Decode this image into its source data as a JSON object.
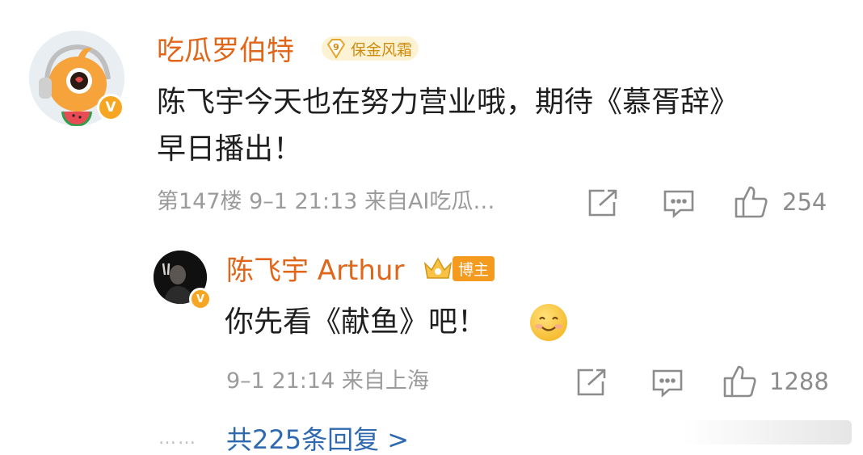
{
  "comment": {
    "username": "吃瓜罗伯特",
    "badge": {
      "level": "9",
      "label": "保金风霜"
    },
    "text_line1": "陈飞宇今天也在努力营业哦，期待《慕胥辞》",
    "text_line2": "早日播出！",
    "meta": "第147楼  9–1 21:13  来自AI吃瓜…",
    "likes": "254"
  },
  "reply": {
    "username": "陈飞宇 Arthur",
    "badge": {
      "label": "博主"
    },
    "text": "你先看《献鱼》吧！",
    "emoji": "😊",
    "meta": "9–1 21:14  来自上海",
    "likes": "1288"
  },
  "footer": {
    "dots": "……",
    "more_replies": "共225条回复 >"
  },
  "colors": {
    "username": "#e0661a",
    "link": "#2f6ab0",
    "verify": "#f6a623",
    "meta": "#9b9b9b"
  },
  "icons": [
    "share-icon",
    "comment-icon",
    "like-icon",
    "verified-icon"
  ]
}
